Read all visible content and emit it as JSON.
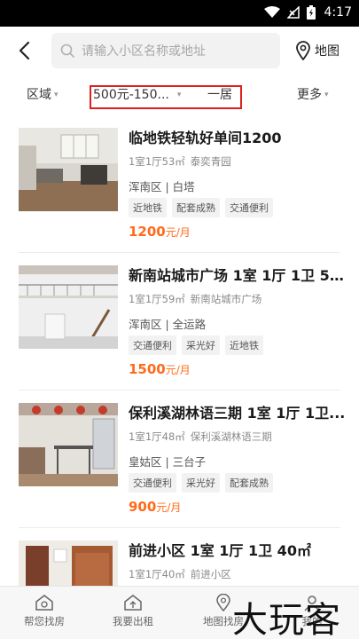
{
  "status_bar": {
    "time": "4:17",
    "icons": [
      "wifi-icon",
      "no-signal-icon",
      "battery-icon"
    ]
  },
  "search": {
    "placeholder": "请输入小区名称或地址",
    "map_label": "地图"
  },
  "filters": {
    "area": "区域",
    "price": "500元-150...",
    "rooms": "一居",
    "more": "更多",
    "highlight_color": "#e0201e"
  },
  "listings": [
    {
      "title": "临地铁轻轨好单间1200",
      "layout": "1室1厅53㎡",
      "community": "泰奕青园",
      "district": "浑南区 | 白塔",
      "tags": [
        "近地铁",
        "配套成熟",
        "交通便利"
      ],
      "price": "1200",
      "unit": "元/月"
    },
    {
      "title": "新南站城市广场 1室 1厅 1卫 5...",
      "layout": "1室1厅59㎡",
      "community": "新南站城市广场",
      "district": "浑南区 | 全运路",
      "tags": [
        "交通便利",
        "采光好",
        "近地铁"
      ],
      "price": "1500",
      "unit": "元/月"
    },
    {
      "title": "保利溪湖林语三期 1室 1厅 1卫...",
      "layout": "1室1厅48㎡",
      "community": "保利溪湖林语三期",
      "district": "皇姑区 | 三台子",
      "tags": [
        "交通便利",
        "采光好",
        "配套成熟"
      ],
      "price": "900",
      "unit": "元/月"
    },
    {
      "title": "前进小区 1室 1厅 1卫 40㎡",
      "layout": "1室1厅40㎡",
      "community": "前进小区",
      "district": "",
      "tags": [],
      "price": "",
      "unit": ""
    }
  ],
  "bottom_nav": [
    {
      "label": "帮您找房",
      "icon": "home-search-icon"
    },
    {
      "label": "我要出租",
      "icon": "rent-out-icon"
    },
    {
      "label": "地图找房",
      "icon": "map-pin-icon"
    },
    {
      "label": "我的",
      "icon": "user-icon"
    }
  ],
  "watermark": "大玩客",
  "colors": {
    "price": "#ff6a1a",
    "accent_red": "#e0201e"
  }
}
